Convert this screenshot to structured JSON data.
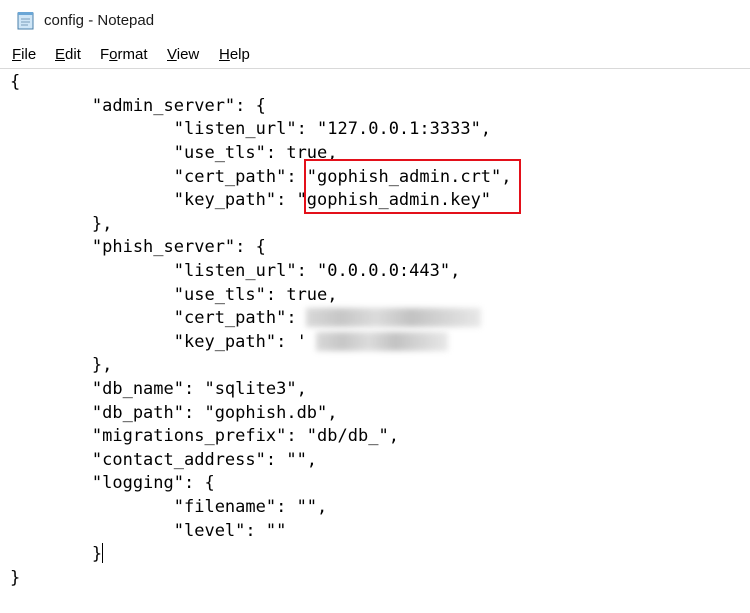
{
  "window": {
    "title": "config - Notepad"
  },
  "menu": {
    "items": [
      {
        "mnemonic": "F",
        "rest": "ile"
      },
      {
        "mnemonic": "E",
        "rest": "dit"
      },
      {
        "mnemonic": "o",
        "pre": "F",
        "rest": "rmat"
      },
      {
        "mnemonic": "V",
        "rest": "iew"
      },
      {
        "mnemonic": "H",
        "rest": "elp"
      }
    ]
  },
  "document": {
    "lines": [
      "{",
      "        \"admin_server\": {",
      "                \"listen_url\": \"127.0.0.1:3333\",",
      "                \"use_tls\": true,",
      "                \"cert_path\": \"gophish_admin.crt\",",
      "                \"key_path\": \"gophish_admin.key\"",
      "        },",
      "        \"phish_server\": {",
      "                \"listen_url\": \"0.0.0.0:443\",",
      "                \"use_tls\": true,",
      "                \"cert_path\": ",
      "                \"key_path\": '",
      "        },",
      "        \"db_name\": \"sqlite3\",",
      "        \"db_path\": \"gophish.db\",",
      "        \"migrations_prefix\": \"db/db_\",",
      "        \"contact_address\": \"\",",
      "        \"logging\": {",
      "                \"filename\": \"\",",
      "                \"level\": \"\"",
      "        }",
      "}"
    ]
  },
  "annotation": {
    "highlight_color": "#e3101a"
  }
}
